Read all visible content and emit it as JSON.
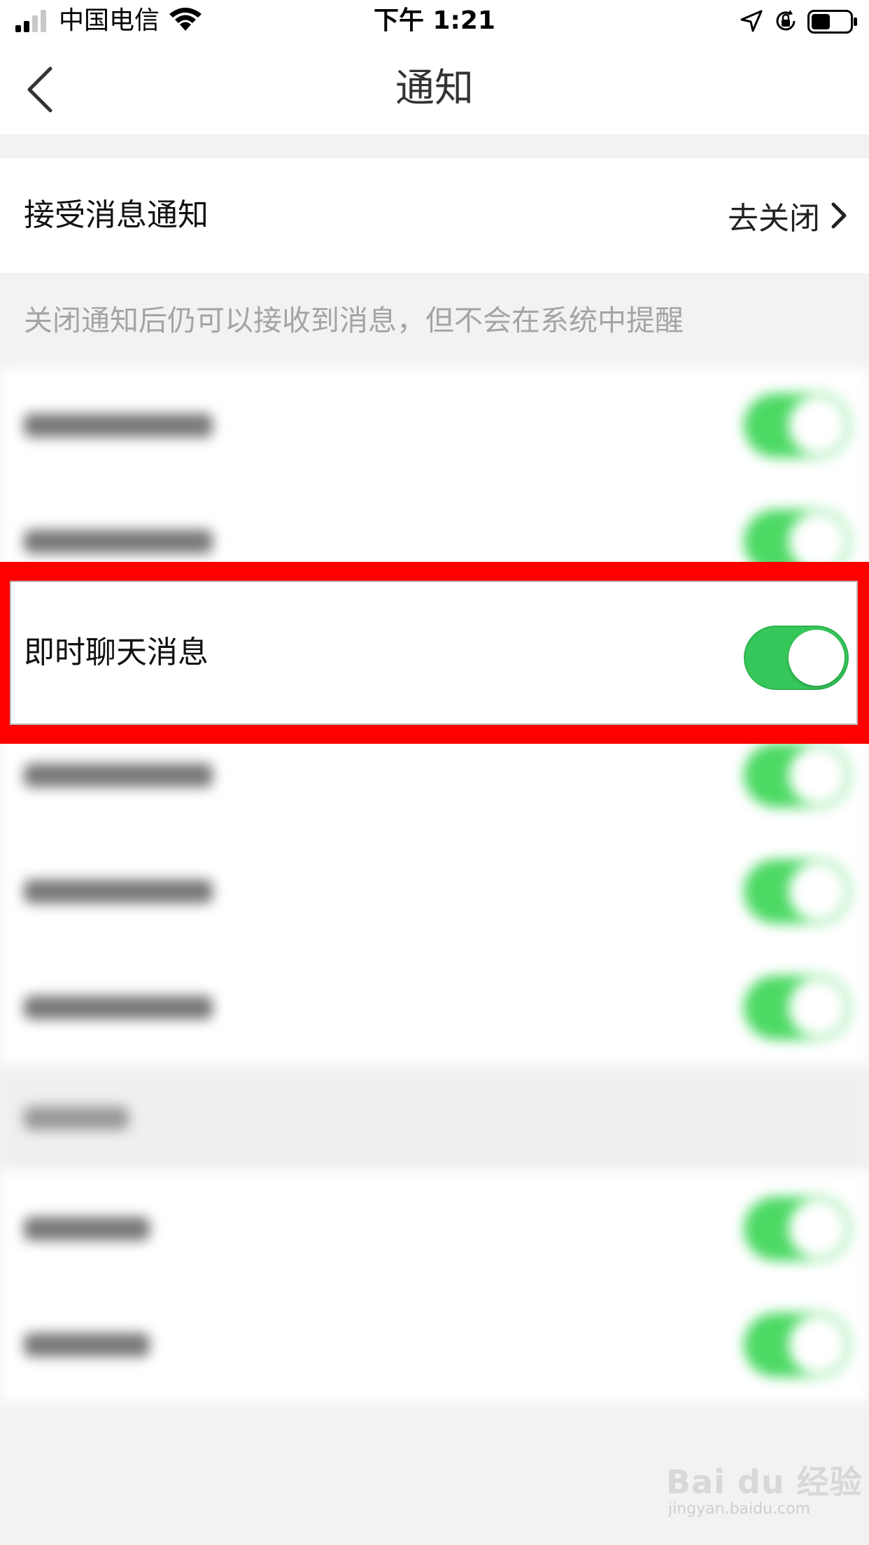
{
  "status_bar": {
    "carrier": "中国电信",
    "time": "下午 1:21",
    "icons": [
      "signal-icon",
      "wifi-icon",
      "location-icon",
      "orientation-lock-icon",
      "battery-icon"
    ]
  },
  "nav": {
    "title": "通知",
    "back_icon": "chevron-left-icon"
  },
  "receive_row": {
    "label": "接受消息通知",
    "value": "去关闭",
    "icon": "chevron-right-icon"
  },
  "hint": "关闭通知后仍可以接收到消息，但不会在系统中提醒",
  "highlighted_row": {
    "label": "即时聊天消息",
    "toggle_on": true
  },
  "colors": {
    "toggle_green": "#35c759",
    "highlight_red": "#ff0000",
    "hint_gray": "#a4a4a4"
  },
  "watermark": {
    "brand": "Bai du 经验",
    "url": "jingyan.baidu.com"
  }
}
